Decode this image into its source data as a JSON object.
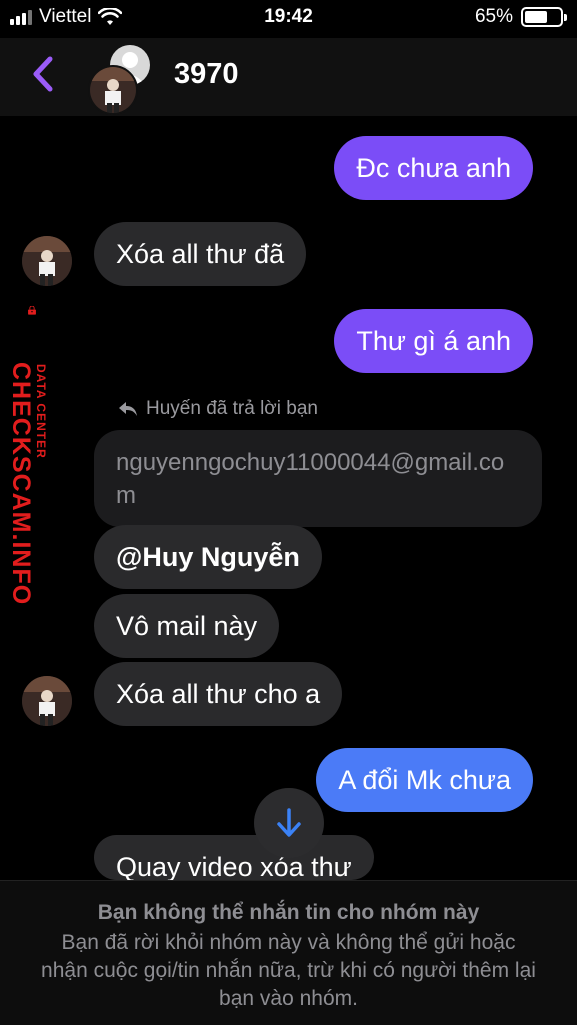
{
  "status_bar": {
    "carrier": "Viettel",
    "time": "19:42",
    "battery": "65%",
    "battery_level": 0.65
  },
  "header": {
    "title": "3970",
    "back_icon": "chevron-left-icon"
  },
  "messages": [
    {
      "id": "m1",
      "direction": "outgoing",
      "text": "Đc chưa anh"
    },
    {
      "id": "m2",
      "direction": "incoming",
      "text": "Xóa all thư đã"
    },
    {
      "id": "m3",
      "direction": "outgoing",
      "text": "Thư gì á anh"
    },
    {
      "id": "m4",
      "direction": "incoming",
      "reply_label": "Huyến đã trả lời bạn",
      "quoted": "nguyenngochuy11000044@gmail.com",
      "text": "@Huy Nguyễn"
    },
    {
      "id": "m5",
      "direction": "incoming",
      "text": "Vô mail này"
    },
    {
      "id": "m6",
      "direction": "incoming",
      "text": "Xóa all thư cho a"
    },
    {
      "id": "m7",
      "direction": "outgoing",
      "text": "A đổi Mk chưa"
    },
    {
      "id": "m8",
      "direction": "incoming",
      "text": "Quay video xóa thư"
    }
  ],
  "footer": {
    "title": "Bạn không thể nhắn tin cho nhóm này",
    "body": "Bạn đã rời khỏi nhóm này và không thể gửi hoặc nhận cuộc gọi/tin nhắn nữa, trừ khi có người thêm lại bạn vào nhóm."
  },
  "watermark": {
    "text": "CHECKSCAM.INFO",
    "subtext": "DATA CENTER"
  },
  "colors": {
    "outgoing_bubble": "#7b4df7",
    "incoming_bubble": "#2a2a2c",
    "accent": "#8b5cf6",
    "watermark": "#e21d1d"
  }
}
